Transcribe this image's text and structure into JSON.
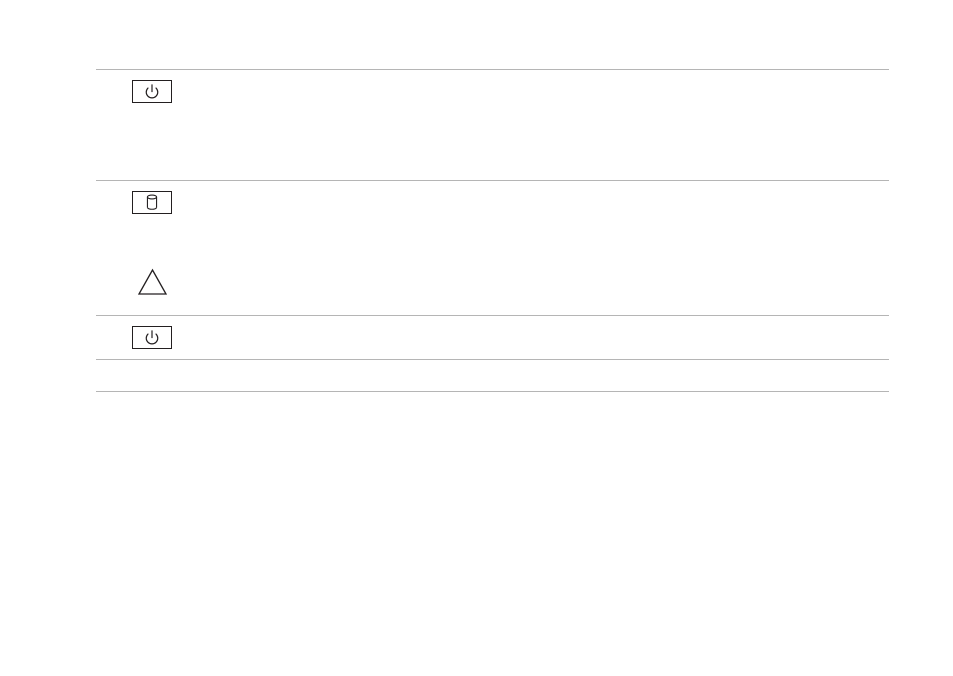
{
  "icons": {
    "row1": "power-icon",
    "row2": "hard-drive-icon",
    "row2_caution": "caution-icon",
    "row3": "power-icon"
  },
  "colors": {
    "rule": "#b5b5b5",
    "icon_stroke": "#231f20"
  }
}
